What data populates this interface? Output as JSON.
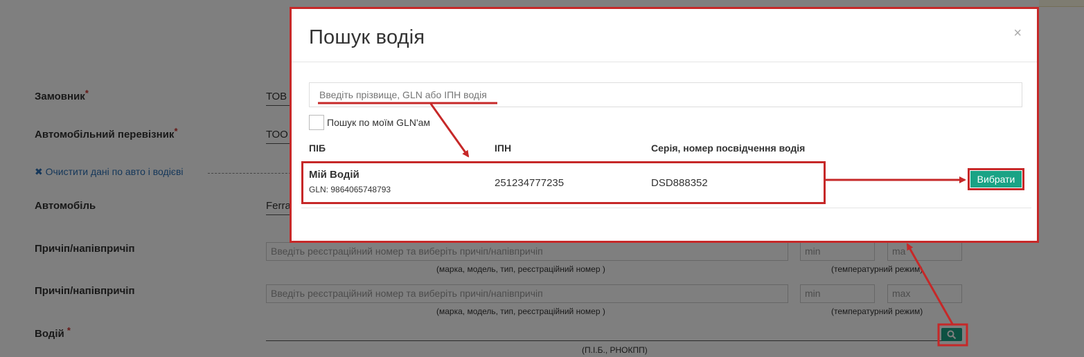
{
  "form": {
    "customer_label": "Замовник",
    "customer_value": "ТОВ",
    "carrier_label": "Автомобільний перевізник",
    "carrier_value": "ТОО",
    "clear_link": "✖ Очистити дані по авто і водієві",
    "car_label": "Автомобіль",
    "car_value": "Ferra",
    "trailer1_label": "Причіп/напівпричіп",
    "trailer1_placeholder": "Введіть реєстраційний номер та виберіть причіп/напівпричіп",
    "trailer1_min": "min",
    "trailer1_max": "ma",
    "trailer2_label": "Причіп/напівпричіп",
    "trailer2_placeholder": "Введіть реєстраційний номер та виберіть причіп/напівпричіп",
    "trailer2_min": "min",
    "trailer2_max": "max",
    "trailer_hint": "(марка, модель, тип, реєстраційний номер )",
    "temp_hint": "(температурний режим)",
    "driver_label": "Водій",
    "driver_hint": "(П.І.Б., РНОКПП)",
    "required_mark": "*"
  },
  "modal": {
    "title": "Пошук водія",
    "close": "×",
    "search_placeholder": "Введіть прізвище, GLN або ІПН водія",
    "checkbox_label": "Пошук по моїм GLN'ам",
    "columns": [
      "ПІБ",
      "ІПН",
      "Серія, номер посвідчення водія"
    ],
    "row": {
      "name": "Мій Водій",
      "gln": "GLN: 9864065748793",
      "ipn": "251234777235",
      "license": "DSD888352"
    },
    "select_button": "Вибрати"
  },
  "colors": {
    "accent_green": "#1aa385",
    "highlight_red": "#c62828",
    "link_blue": "#2a6fb5"
  }
}
